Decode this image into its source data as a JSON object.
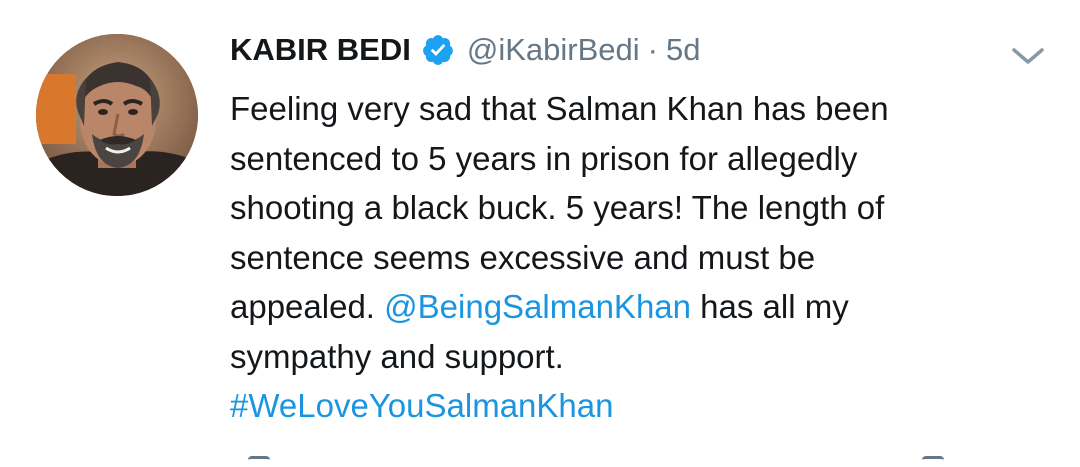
{
  "tweet": {
    "author": {
      "display_name": "KABIR BEDI",
      "handle": "@iKabirBedi",
      "verified": true,
      "avatar_icon": "profile-photo"
    },
    "separator": "·",
    "time": "5d",
    "menu_icon": "chevron-down-icon",
    "text_lines": [
      [
        {
          "text": "Feeling very sad that Salman Khan has been",
          "type": "text"
        }
      ],
      [
        {
          "text": "sentenced to 5 years in prison for allegedly",
          "type": "text"
        }
      ],
      [
        {
          "text": "shooting a black buck. 5 years! The length of",
          "type": "text"
        }
      ],
      [
        {
          "text": "sentence seems excessive and must be",
          "type": "text"
        }
      ],
      [
        {
          "text": "appealed. ",
          "type": "text"
        },
        {
          "text": "@BeingSalmanKhan",
          "type": "mention"
        },
        {
          "text": " has all my",
          "type": "text"
        }
      ],
      [
        {
          "text": "sympathy and support.",
          "type": "text"
        }
      ],
      [
        {
          "text": "#WeLoveYouSalmanKhan",
          "type": "hashtag"
        }
      ]
    ],
    "colors": {
      "text": "#14171a",
      "secondary": "#657786",
      "link": "#1b95e0",
      "verified": "#1da1f2"
    }
  }
}
